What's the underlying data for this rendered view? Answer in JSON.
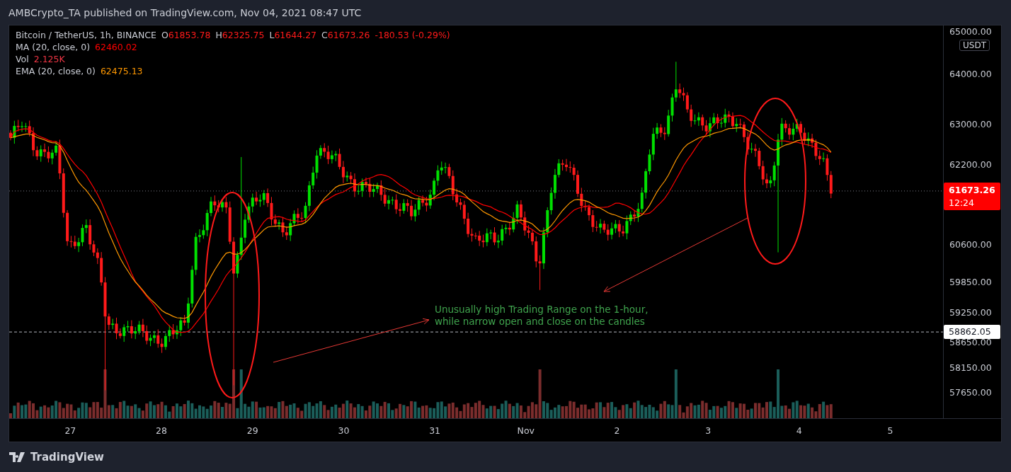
{
  "header": {
    "publisher_line": "AMBCrypto_TA published on TradingView.com, Nov 04, 2021 08:47 UTC"
  },
  "legend": {
    "symbol": "Bitcoin / TetherUS, 1h, BINANCE",
    "ohlc": [
      {
        "prefix": "O",
        "value": "61853.78"
      },
      {
        "prefix": "H",
        "value": "62325.75"
      },
      {
        "prefix": "L",
        "value": "61644.27"
      },
      {
        "prefix": "C",
        "value": "61673.26"
      }
    ],
    "change": "-180.53 (-0.29%)",
    "indicators": [
      {
        "name": "MA (20, close, 0)",
        "value": "62460.02",
        "color": "#ff0000"
      },
      {
        "name": "Vol",
        "value": "2.125K",
        "color": "#f23645"
      },
      {
        "name": "EMA (20, close, 0)",
        "value": "62475.13",
        "color": "#ff9800"
      }
    ]
  },
  "price_axis": {
    "currency": "USDT",
    "ticks": [
      "65000.00",
      "64000.00",
      "63000.00",
      "62200.00",
      "60600.00",
      "59850.00",
      "59250.00",
      "58650.00",
      "58150.00",
      "57650.00"
    ],
    "last_price": {
      "value": "61673.26",
      "countdown": "12:24"
    },
    "marked_price": "58862.05"
  },
  "time_axis": {
    "labels": [
      "27",
      "28",
      "29",
      "30",
      "31",
      "Nov",
      "2",
      "3",
      "4",
      "5"
    ]
  },
  "annotation": {
    "text": "Unusually high Trading Range on the 1-hour,\nwhile narrow open and close on the candles"
  },
  "footer": {
    "brand": "TradingView"
  }
}
